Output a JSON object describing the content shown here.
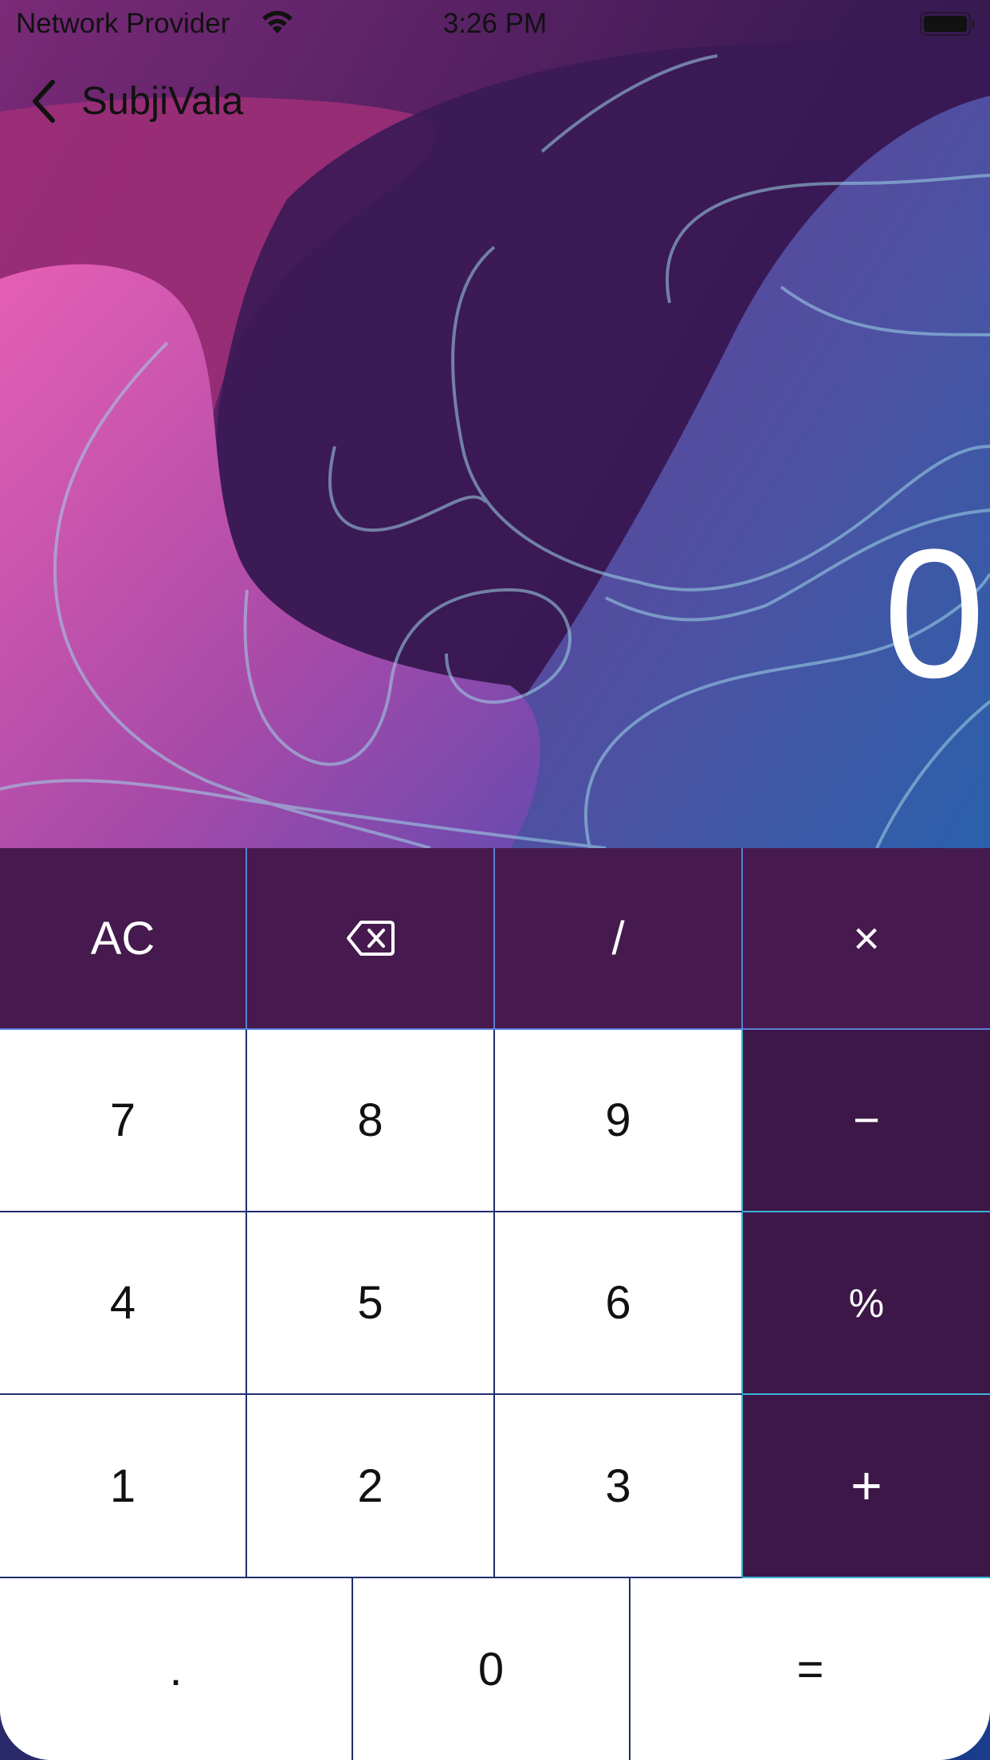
{
  "status_bar": {
    "carrier": "Network Provider",
    "time": "3:26 PM"
  },
  "nav": {
    "back_label": "SubjiVala"
  },
  "display": {
    "value": "0"
  },
  "keys": {
    "row1": [
      "AC",
      "",
      "/",
      "×"
    ],
    "row2": [
      "7",
      "8",
      "9",
      "−"
    ],
    "row3": [
      "4",
      "5",
      "6",
      "%"
    ],
    "row4": [
      "1",
      "2",
      "3",
      "+"
    ],
    "row5": [
      ".",
      "0",
      "="
    ]
  },
  "icons": {
    "wifi": "wifi-icon",
    "battery": "battery-icon",
    "back": "chevron-left-icon",
    "backspace": "backspace-icon"
  },
  "colors": {
    "function_key_bg": "#461a4e",
    "operator_key_bg": "#3c1747",
    "number_key_bg": "#ffffff",
    "display_text": "#ffffff"
  }
}
